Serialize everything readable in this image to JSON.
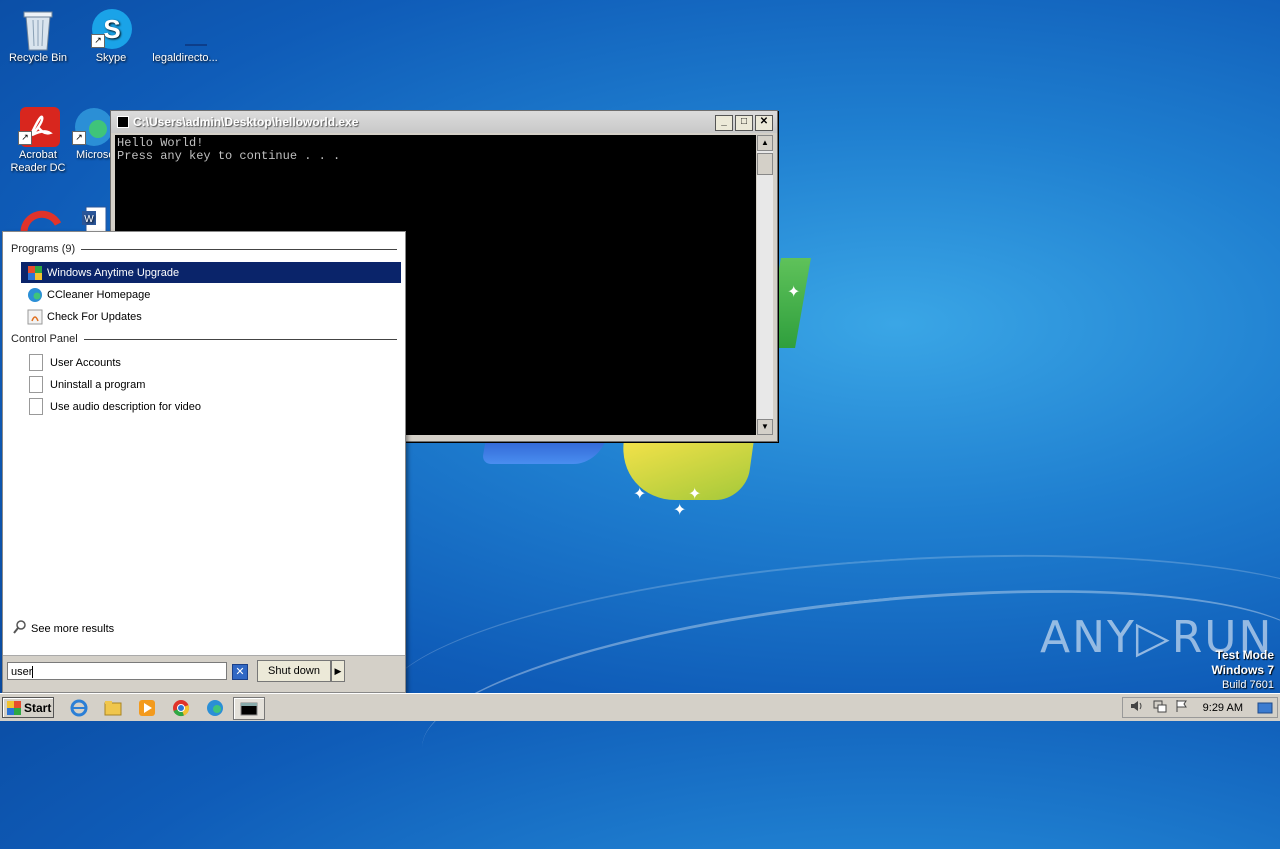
{
  "desktop": {
    "icons": [
      {
        "label": "Recycle Bin",
        "icon": "recycle-bin-icon"
      },
      {
        "label": "Skype",
        "icon": "skype-icon"
      },
      {
        "label": "legaldirecto...",
        "icon": "file-icon"
      },
      {
        "label": "Acrobat Reader DC",
        "icon": "acrobat-icon"
      },
      {
        "label": "Microso",
        "icon": "edge-icon"
      }
    ]
  },
  "console": {
    "title": "C:\\Users\\admin\\Desktop\\helloworld.exe",
    "lines": [
      "Hello World!",
      "Press any key to continue . . ."
    ]
  },
  "start_menu": {
    "programs_header": "Programs (9)",
    "programs": [
      {
        "label": "Windows Anytime Upgrade",
        "selected": true
      },
      {
        "label": "CCleaner Homepage",
        "selected": false
      },
      {
        "label": "Check For Updates",
        "selected": false
      }
    ],
    "control_panel_header": "Control Panel",
    "control_panel": [
      {
        "label": "User Accounts"
      },
      {
        "label": "Uninstall a program"
      },
      {
        "label": "Use audio description for video"
      }
    ],
    "see_more": "See more results",
    "search_value": "user",
    "shutdown_label": "Shut down"
  },
  "taskbar": {
    "start_label": "Start",
    "clock": "9:29 AM"
  },
  "watermark": {
    "anyrun": "ANY▷RUN",
    "line1": "Test Mode",
    "line2": "Windows 7",
    "line3": "Build 7601"
  },
  "colors": {
    "selection": "#0a246a",
    "console_bg": "#000000",
    "console_text": "#c0c0c0"
  }
}
